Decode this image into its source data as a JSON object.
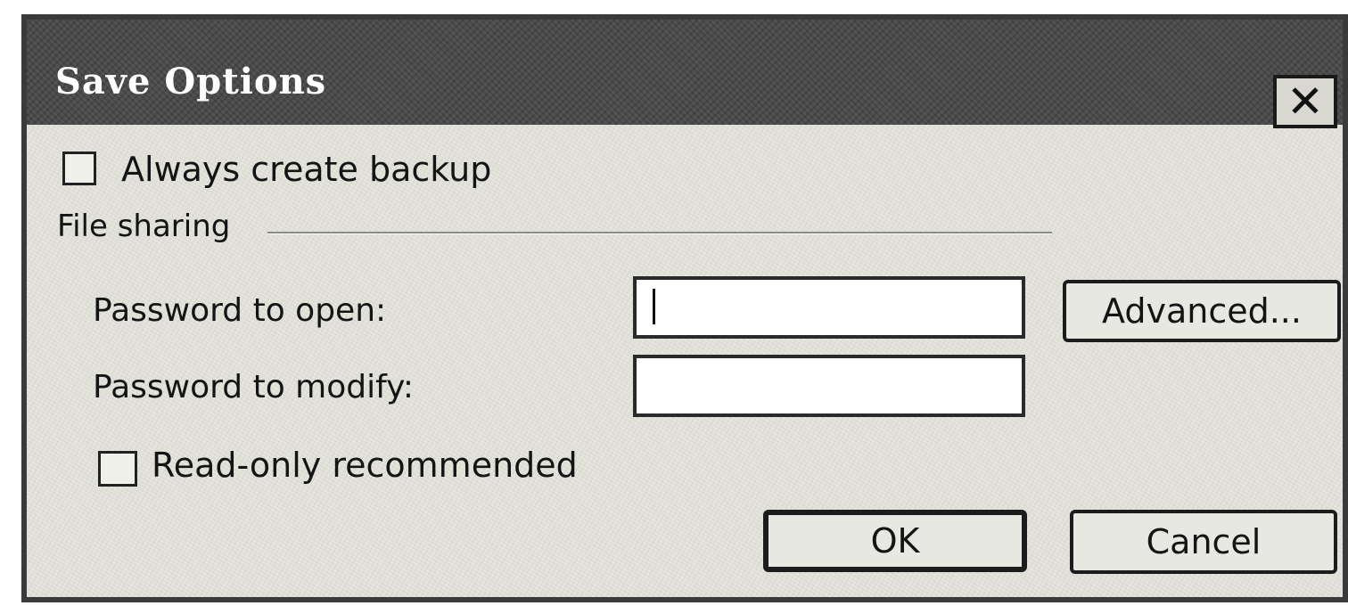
{
  "dialog": {
    "title": "Save Options",
    "close_glyph": "✕",
    "close_icon": "close-icon"
  },
  "backup": {
    "label": "Always create backup",
    "checked": false
  },
  "file_sharing": {
    "group_label": "File sharing",
    "password_open_label": "Password to open:",
    "password_open_value": "",
    "password_modify_label": "Password to modify:",
    "password_modify_value": "",
    "advanced_label": "Advanced...",
    "readonly_label": "Read-only recommended",
    "readonly_checked": false
  },
  "buttons": {
    "ok_label": "OK",
    "cancel_label": "Cancel"
  }
}
